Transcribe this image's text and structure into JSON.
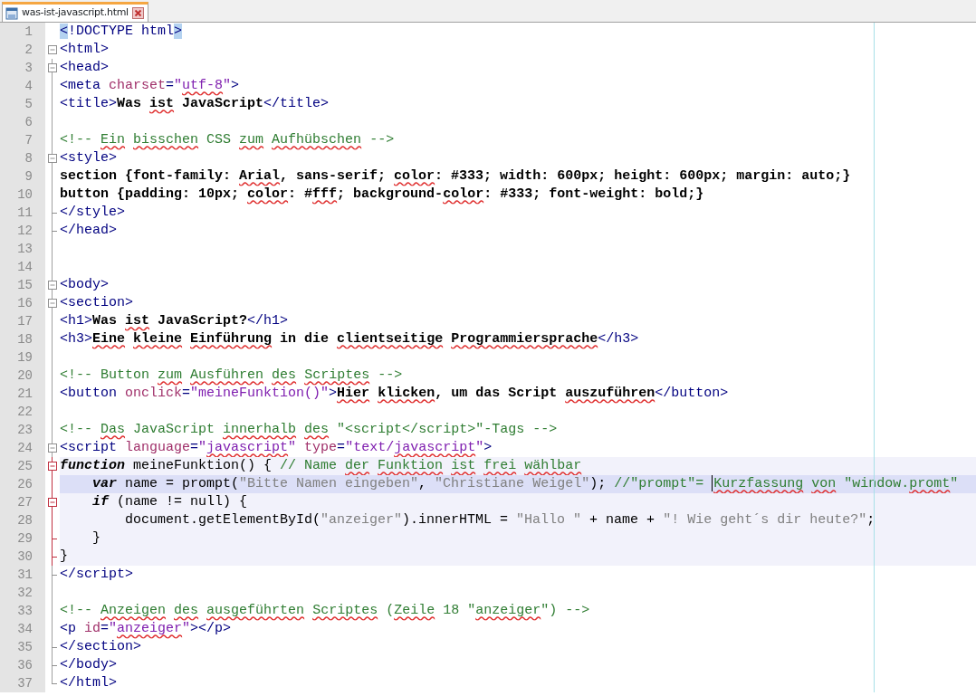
{
  "tab": {
    "label": "was-ist-javascript.html",
    "selected": true
  },
  "lines": [
    {
      "number": "1",
      "fold_open": false,
      "fold_end": false,
      "tokens": [
        {
          "kind": "match",
          "text": "<"
        },
        {
          "kind": "tag",
          "text": "!DOCTYPE html"
        },
        {
          "kind": "match",
          "text": ">"
        }
      ]
    },
    {
      "number": "2",
      "fold_open": true,
      "fold_end": false,
      "tokens": [
        {
          "kind": "tag",
          "text": "<html>"
        }
      ]
    },
    {
      "number": "3",
      "fold_open": true,
      "fold_end": false,
      "tokens": [
        {
          "kind": "tag",
          "text": "<head>"
        }
      ]
    },
    {
      "number": "4",
      "fold_open": false,
      "fold_end": false,
      "tokens": [
        {
          "kind": "tag",
          "text": "<meta "
        },
        {
          "kind": "attr",
          "text": "charset"
        },
        {
          "kind": "tag",
          "text": "="
        },
        {
          "kind": "value",
          "text": "\""
        },
        {
          "kind": "value",
          "text": "utf-8",
          "underlined": true
        },
        {
          "kind": "value",
          "text": "\""
        },
        {
          "kind": "tag",
          "text": ">"
        }
      ]
    },
    {
      "number": "5",
      "fold_open": false,
      "fold_end": false,
      "tokens": [
        {
          "kind": "tag",
          "text": "<title>"
        },
        {
          "kind": "text",
          "text": "Was "
        },
        {
          "kind": "text",
          "text": "ist ",
          "underlined": true
        },
        {
          "kind": "text",
          "text": "JavaScript"
        },
        {
          "kind": "tag",
          "text": "</title>"
        }
      ]
    },
    {
      "number": "6",
      "fold_open": false,
      "fold_end": false
    },
    {
      "number": "7",
      "fold_open": false,
      "fold_end": false,
      "tokens": [
        {
          "kind": "comment",
          "text": "<!-- "
        },
        {
          "kind": "comment",
          "text": "Ein ",
          "underlined": true
        },
        {
          "kind": "comment",
          "text": "bisschen",
          "underlined": true
        },
        {
          "kind": "comment",
          "text": " CSS "
        },
        {
          "kind": "comment",
          "text": "zum ",
          "underlined": true
        },
        {
          "kind": "comment",
          "text": "Aufhübschen",
          "underlined": true
        },
        {
          "kind": "comment",
          "text": " -->"
        }
      ]
    },
    {
      "number": "8",
      "fold_open": true,
      "fold_end": false,
      "tokens": [
        {
          "kind": "tag",
          "text": "<style>"
        }
      ]
    },
    {
      "number": "9",
      "fold_open": false,
      "fold_end": false,
      "tokens": [
        {
          "kind": "text",
          "text": "section {font-family: "
        },
        {
          "kind": "text",
          "text": "Arial",
          "underlined": true
        },
        {
          "kind": "text",
          "text": ", sans-serif; "
        },
        {
          "kind": "text",
          "text": "color",
          "underlined": true
        },
        {
          "kind": "text",
          "text": ": #333; width: 600px; height: 600px; margin: auto;}"
        }
      ]
    },
    {
      "number": "10",
      "fold_open": false,
      "fold_end": false,
      "tokens": [
        {
          "kind": "text",
          "text": "button {padding: 10px; "
        },
        {
          "kind": "text",
          "text": "color",
          "underlined": true
        },
        {
          "kind": "text",
          "text": ": #"
        },
        {
          "kind": "text",
          "text": "fff",
          "underlined": true
        },
        {
          "kind": "text",
          "text": "; background-"
        },
        {
          "kind": "text",
          "text": "color",
          "underlined": true
        },
        {
          "kind": "text",
          "text": ": #333; font-weight: bold;}"
        }
      ]
    },
    {
      "number": "11",
      "fold_open": false,
      "fold_end": true,
      "tokens": [
        {
          "kind": "tag",
          "text": "</style>"
        }
      ]
    },
    {
      "number": "12",
      "fold_open": false,
      "fold_end": true,
      "tokens": [
        {
          "kind": "tag",
          "text": "</head>"
        }
      ]
    },
    {
      "number": "13",
      "fold_open": false,
      "fold_end": false
    },
    {
      "number": "14",
      "fold_open": false,
      "fold_end": false
    },
    {
      "number": "15",
      "fold_open": true,
      "fold_end": false,
      "tokens": [
        {
          "kind": "tag",
          "text": "<body>"
        }
      ]
    },
    {
      "number": "16",
      "fold_open": true,
      "fold_end": false,
      "tokens": [
        {
          "kind": "tag",
          "text": "<section>"
        }
      ]
    },
    {
      "number": "17",
      "fold_open": false,
      "fold_end": false,
      "tokens": [
        {
          "kind": "tag",
          "text": "<h1>"
        },
        {
          "kind": "text",
          "text": "Was "
        },
        {
          "kind": "text",
          "text": "ist ",
          "underlined": true
        },
        {
          "kind": "text",
          "text": "JavaScript?"
        },
        {
          "kind": "tag",
          "text": "</h1>"
        }
      ]
    },
    {
      "number": "18",
      "fold_open": false,
      "fold_end": false,
      "tokens": [
        {
          "kind": "tag",
          "text": "<h3>"
        },
        {
          "kind": "text",
          "text": "Eine ",
          "underlined": true
        },
        {
          "kind": "text",
          "text": "kleine ",
          "underlined": true
        },
        {
          "kind": "text",
          "text": "Einführung",
          "underlined": true
        },
        {
          "kind": "text",
          "text": " in die "
        },
        {
          "kind": "text",
          "text": "clientseitige ",
          "underlined": true
        },
        {
          "kind": "text",
          "text": "Programmiersprache",
          "underlined": true
        },
        {
          "kind": "tag",
          "text": "</h3>"
        }
      ]
    },
    {
      "number": "19",
      "fold_open": false,
      "fold_end": false
    },
    {
      "number": "20",
      "fold_open": false,
      "fold_end": false,
      "tokens": [
        {
          "kind": "comment",
          "text": "<!-- Button "
        },
        {
          "kind": "comment",
          "text": "zum ",
          "underlined": true
        },
        {
          "kind": "comment",
          "text": "Ausführen ",
          "underlined": true
        },
        {
          "kind": "comment",
          "text": "des ",
          "underlined": true
        },
        {
          "kind": "comment",
          "text": "Scriptes",
          "underlined": true
        },
        {
          "kind": "comment",
          "text": " -->"
        }
      ]
    },
    {
      "number": "21",
      "fold_open": false,
      "fold_end": false,
      "tokens": [
        {
          "kind": "tag",
          "text": "<button "
        },
        {
          "kind": "attr",
          "text": "onclick"
        },
        {
          "kind": "tag",
          "text": "="
        },
        {
          "kind": "value",
          "text": "\"meineFunktion()\""
        },
        {
          "kind": "tag",
          "text": ">"
        },
        {
          "kind": "text",
          "text": "Hier ",
          "underlined": true
        },
        {
          "kind": "text",
          "text": "klicken",
          "underlined": true
        },
        {
          "kind": "text",
          "text": ", um das Script "
        },
        {
          "kind": "text",
          "text": "auszuführen",
          "underlined": true
        },
        {
          "kind": "tag",
          "text": "</button>"
        }
      ]
    },
    {
      "number": "22",
      "fold_open": false,
      "fold_end": false
    },
    {
      "number": "23",
      "fold_open": false,
      "fold_end": false,
      "tokens": [
        {
          "kind": "comment",
          "text": "<!-- "
        },
        {
          "kind": "comment",
          "text": "Das",
          "underlined": true
        },
        {
          "kind": "comment",
          "text": " JavaScript "
        },
        {
          "kind": "comment",
          "text": "innerhalb ",
          "underlined": true
        },
        {
          "kind": "comment",
          "text": "des",
          "underlined": true
        },
        {
          "kind": "comment",
          "text": " \"<script</script>\"-Tags -->"
        }
      ]
    },
    {
      "number": "24",
      "fold_open": true,
      "fold_end": false,
      "tokens": [
        {
          "kind": "tag",
          "text": "<script "
        },
        {
          "kind": "attr",
          "text": "language"
        },
        {
          "kind": "tag",
          "text": "="
        },
        {
          "kind": "value",
          "text": "\""
        },
        {
          "kind": "value",
          "text": "javascript",
          "underlined": true
        },
        {
          "kind": "value",
          "text": "\""
        },
        {
          "kind": "attr",
          "text": " type"
        },
        {
          "kind": "tag",
          "text": "="
        },
        {
          "kind": "value",
          "text": "\"text/"
        },
        {
          "kind": "value",
          "text": "javascript",
          "underlined": true
        },
        {
          "kind": "value",
          "text": "\""
        },
        {
          "kind": "tag",
          "text": ">"
        }
      ]
    },
    {
      "number": "25",
      "fold_open": true,
      "fold_end": false,
      "script": true,
      "current": false,
      "tokens": [
        {
          "kind": "jskw",
          "text": "function"
        },
        {
          "kind": "plain",
          "text": " meineFunktion() { "
        },
        {
          "kind": "jscomment",
          "text": "// Name "
        },
        {
          "kind": "jscomment",
          "text": "der ",
          "underlined": true
        },
        {
          "kind": "jscomment",
          "text": "Funktion ",
          "underlined": true
        },
        {
          "kind": "jscomment",
          "text": "ist ",
          "underlined": true
        },
        {
          "kind": "jscomment",
          "text": "frei ",
          "underlined": true
        },
        {
          "kind": "jscomment",
          "text": "wählbar",
          "underlined": true
        }
      ]
    },
    {
      "number": "26",
      "fold_open": false,
      "fold_end": false,
      "script": true,
      "current": true,
      "tokens": [
        {
          "kind": "jskw",
          "text": "    var"
        },
        {
          "kind": "plain",
          "text": " name = prompt("
        },
        {
          "kind": "jsstr",
          "text": "\"Bitte Namen eingeben\""
        },
        {
          "kind": "plain",
          "text": ", "
        },
        {
          "kind": "jsstr",
          "text": "\"Christiane Weigel\""
        },
        {
          "kind": "plain",
          "text": "); "
        },
        {
          "kind": "jscomment",
          "text": "//\"prompt\"= "
        },
        {
          "kind": "jscomment",
          "text": "Kurzfassung ",
          "underlined": true,
          "caret": true
        },
        {
          "kind": "jscomment",
          "text": "von",
          "underlined": true
        },
        {
          "kind": "jscomment",
          "text": " \"window."
        },
        {
          "kind": "jscomment",
          "text": "promt",
          "underlined": true
        },
        {
          "kind": "jscomment",
          "text": "\""
        }
      ]
    },
    {
      "number": "27",
      "fold_open": true,
      "fold_end": false,
      "script": true,
      "current": false,
      "tokens": [
        {
          "kind": "jskw",
          "text": "    if"
        },
        {
          "kind": "plain",
          "text": " (name != null) {"
        }
      ]
    },
    {
      "number": "28",
      "fold_open": false,
      "fold_end": false,
      "script": true,
      "current": false,
      "tokens": [
        {
          "kind": "plain",
          "text": "        document.getElementById("
        },
        {
          "kind": "jsstr",
          "text": "\"anzeiger\""
        },
        {
          "kind": "plain",
          "text": ").innerHTML = "
        },
        {
          "kind": "jsstr",
          "text": "\"Hallo \""
        },
        {
          "kind": "plain",
          "text": " + name + "
        },
        {
          "kind": "jsstr",
          "text": "\"! Wie geht´s dir heute?\""
        },
        {
          "kind": "plain",
          "text": ";"
        }
      ]
    },
    {
      "number": "29",
      "fold_open": false,
      "fold_end": true,
      "script": true,
      "current": false,
      "tokens": [
        {
          "kind": "plain",
          "text": "    }"
        }
      ]
    },
    {
      "number": "30",
      "fold_open": false,
      "fold_end": true,
      "script": true,
      "current": false,
      "tokens": [
        {
          "kind": "plain",
          "text": "}"
        }
      ]
    },
    {
      "number": "31",
      "fold_open": false,
      "fold_end": true,
      "tokens": [
        {
          "kind": "tag",
          "text": "</script>"
        }
      ]
    },
    {
      "number": "32",
      "fold_open": false,
      "fold_end": false
    },
    {
      "number": "33",
      "fold_open": false,
      "fold_end": false,
      "tokens": [
        {
          "kind": "comment",
          "text": "<!-- "
        },
        {
          "kind": "comment",
          "text": "Anzeigen ",
          "underlined": true
        },
        {
          "kind": "comment",
          "text": "des ",
          "underlined": true
        },
        {
          "kind": "comment",
          "text": "ausgeführten ",
          "underlined": true
        },
        {
          "kind": "comment",
          "text": "Scriptes",
          "underlined": true
        },
        {
          "kind": "comment",
          "text": " ("
        },
        {
          "kind": "comment",
          "text": "Zeile",
          "underlined": true
        },
        {
          "kind": "comment",
          "text": " 18 \""
        },
        {
          "kind": "comment",
          "text": "anzeiger",
          "underlined": true
        },
        {
          "kind": "comment",
          "text": "\") -->"
        }
      ]
    },
    {
      "number": "34",
      "fold_open": false,
      "fold_end": false,
      "tokens": [
        {
          "kind": "tag",
          "text": "<p "
        },
        {
          "kind": "attr",
          "text": "id"
        },
        {
          "kind": "tag",
          "text": "="
        },
        {
          "kind": "value",
          "text": "\""
        },
        {
          "kind": "value",
          "text": "anzeiger",
          "underlined": true
        },
        {
          "kind": "value",
          "text": "\""
        },
        {
          "kind": "tag",
          "text": "></p>"
        }
      ]
    },
    {
      "number": "35",
      "fold_open": false,
      "fold_end": true,
      "tokens": [
        {
          "kind": "tag",
          "text": "</section>"
        }
      ]
    },
    {
      "number": "36",
      "fold_open": false,
      "fold_end": true,
      "tokens": [
        {
          "kind": "tag",
          "text": "</body>"
        }
      ]
    },
    {
      "number": "37",
      "fold_open": false,
      "fold_end": true,
      "tokens": [
        {
          "kind": "tag",
          "text": "</html>"
        }
      ]
    }
  ]
}
